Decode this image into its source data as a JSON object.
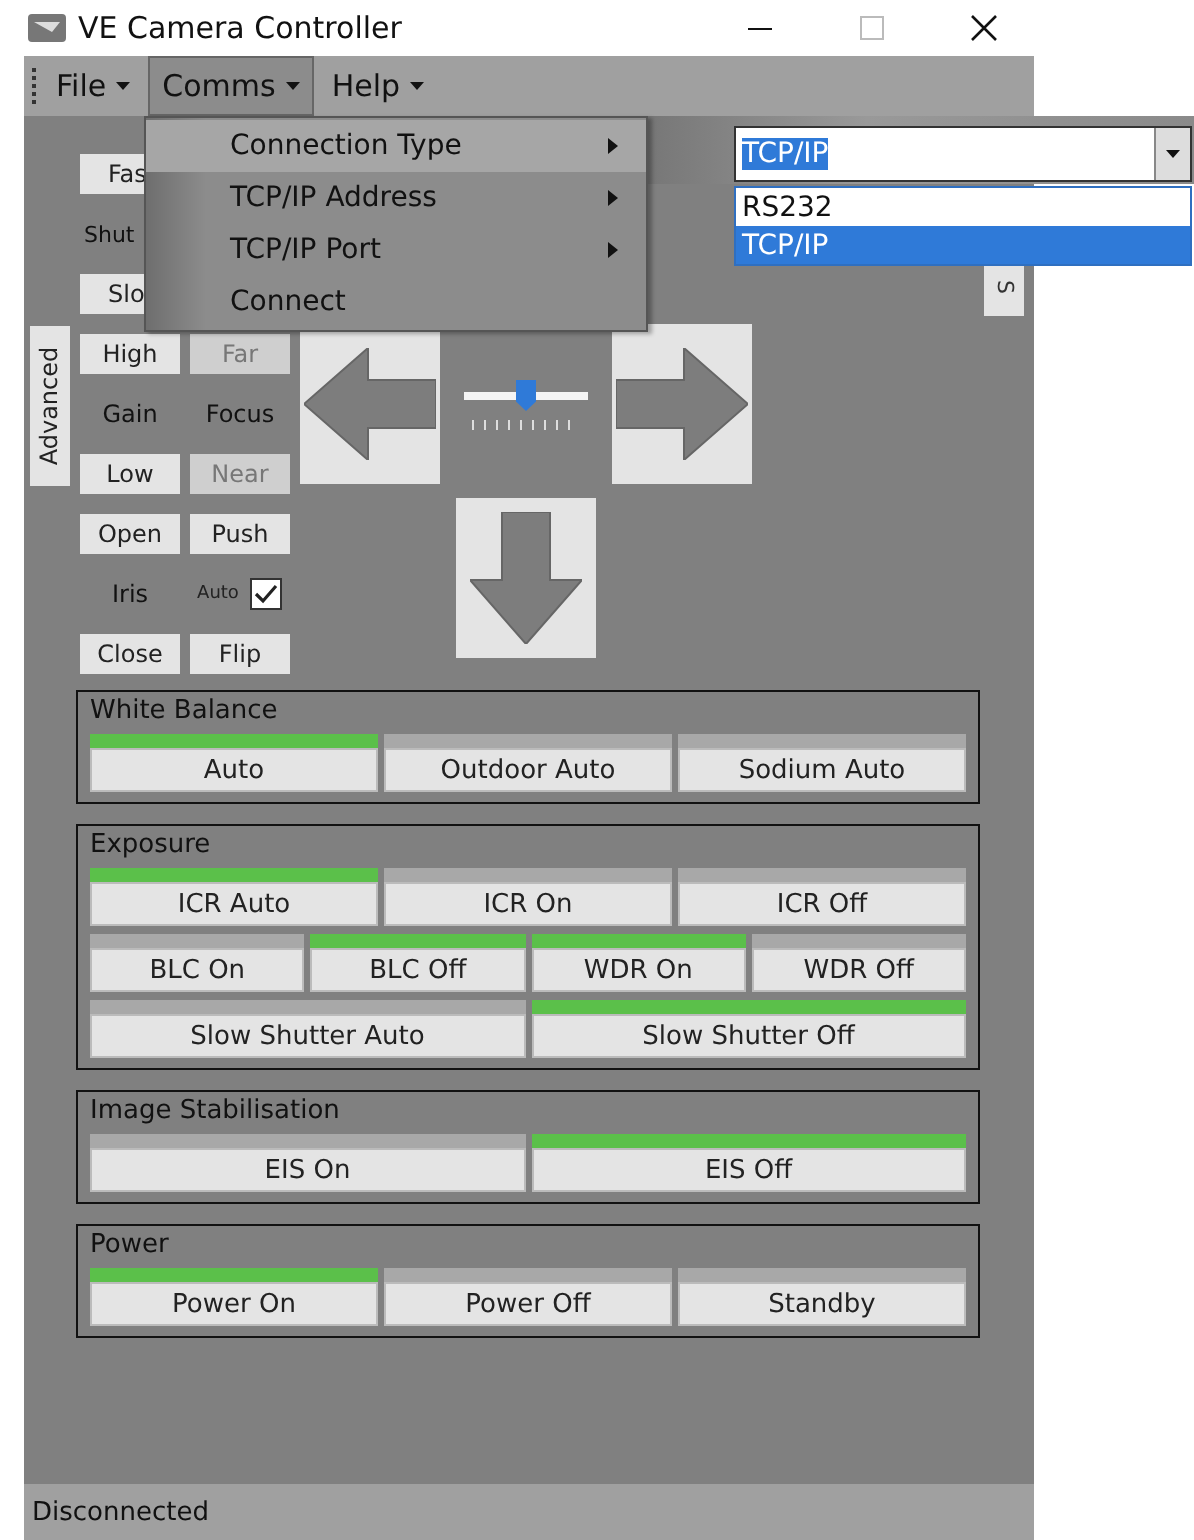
{
  "window": {
    "title": "VE Camera Controller"
  },
  "menu": [
    {
      "label": "File",
      "selected": false
    },
    {
      "label": "Comms",
      "selected": true
    },
    {
      "label": "Help",
      "selected": false
    }
  ],
  "comms_menu": [
    {
      "label": "Connection Type",
      "submenu": true,
      "selected": true
    },
    {
      "label": "TCP/IP Address",
      "submenu": true,
      "selected": false
    },
    {
      "label": "TCP/IP Port",
      "submenu": true,
      "selected": false
    },
    {
      "label": "Connect",
      "submenu": false,
      "selected": false
    }
  ],
  "connection_combo": {
    "value": "TCP/IP",
    "options": [
      {
        "label": "RS232",
        "selected": false
      },
      {
        "label": "TCP/IP",
        "selected": true
      }
    ]
  },
  "side_tab": {
    "label": "Advanced"
  },
  "right_tab": {
    "label": "S"
  },
  "controls": [
    [
      {
        "kind": "partial",
        "label": "Fas"
      }
    ],
    [
      {
        "kind": "partial-label",
        "label": "Shut"
      }
    ],
    [
      {
        "kind": "partial",
        "label": "Slo"
      }
    ],
    [
      {
        "kind": "button",
        "label": "High",
        "disabled": false
      },
      {
        "kind": "button",
        "label": "Far",
        "disabled": true
      }
    ],
    [
      {
        "kind": "label",
        "label": "Gain"
      },
      {
        "kind": "label",
        "label": "Focus"
      }
    ],
    [
      {
        "kind": "button",
        "label": "Low",
        "disabled": false
      },
      {
        "kind": "button",
        "label": "Near",
        "disabled": true
      }
    ],
    [
      {
        "kind": "button",
        "label": "Open",
        "disabled": false
      },
      {
        "kind": "button",
        "label": "Push",
        "disabled": false
      }
    ],
    [
      {
        "kind": "label",
        "label": "Iris"
      },
      {
        "kind": "check",
        "label": "Auto",
        "checked": true
      }
    ],
    [
      {
        "kind": "button",
        "label": "Close",
        "disabled": false
      },
      {
        "kind": "button",
        "label": "Flip",
        "disabled": false
      }
    ]
  ],
  "zoom_slider": {
    "level": 0.5
  },
  "groups": [
    {
      "title": "White Balance",
      "rows": [
        [
          {
            "label": "Auto",
            "selected": true
          },
          {
            "label": "Outdoor Auto",
            "selected": false
          },
          {
            "label": "Sodium Auto",
            "selected": false
          }
        ]
      ]
    },
    {
      "title": "Exposure",
      "rows": [
        [
          {
            "label": "ICR Auto",
            "selected": true
          },
          {
            "label": "ICR On",
            "selected": false
          },
          {
            "label": "ICR Off",
            "selected": false
          }
        ]
      ],
      "rows_2": [
        [
          {
            "label": "BLC On",
            "selected": false
          },
          {
            "label": "BLC Off",
            "selected": true
          },
          {
            "label": "WDR On",
            "selected": true
          },
          {
            "label": "WDR Off",
            "selected": false
          }
        ]
      ],
      "rows_3": [
        [
          {
            "label": "Slow Shutter Auto",
            "selected": false
          },
          {
            "label": "Slow Shutter Off",
            "selected": true
          }
        ]
      ]
    },
    {
      "title": "Image Stabilisation",
      "rows": [
        [
          {
            "label": "EIS On",
            "selected": false
          },
          {
            "label": "EIS Off",
            "selected": true
          }
        ]
      ]
    },
    {
      "title": "Power",
      "rows": [
        [
          {
            "label": "Power On",
            "selected": true
          },
          {
            "label": "Power Off",
            "selected": false
          },
          {
            "label": "Standby",
            "selected": false
          }
        ]
      ]
    }
  ],
  "status_bar": {
    "text": "Disconnected"
  }
}
